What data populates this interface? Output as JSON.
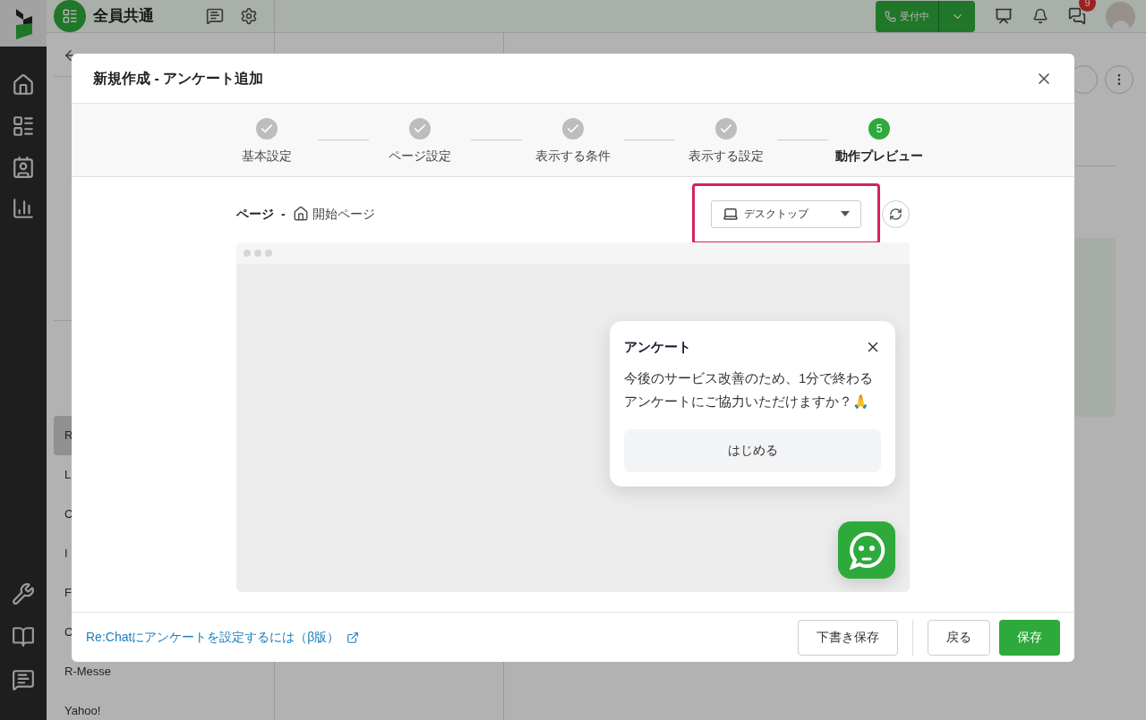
{
  "topbar": {
    "workspace": "全員共通",
    "status_button": "受付中",
    "notification_count": "9"
  },
  "sidebar": {
    "items": [
      {
        "label": "R",
        "selected": true
      },
      {
        "label": "L",
        "selected": false
      },
      {
        "label": "C",
        "selected": false
      },
      {
        "label": "I",
        "selected": false
      },
      {
        "label": "F",
        "selected": false
      },
      {
        "label": "C",
        "selected": false
      },
      {
        "label": "R-Messe",
        "selected": false
      },
      {
        "label": "Yahoo!",
        "selected": false
      }
    ]
  },
  "modal": {
    "title": "新規作成 - アンケート追加",
    "steps": [
      {
        "label": "基本設定",
        "done": true,
        "current": false
      },
      {
        "label": "ページ設定",
        "done": true,
        "current": false
      },
      {
        "label": "表示する条件",
        "done": true,
        "current": false
      },
      {
        "label": "表示する設定",
        "done": true,
        "current": false
      },
      {
        "label": "動作プレビュー",
        "done": false,
        "current": true,
        "number": "5"
      }
    ],
    "page_label": "ページ",
    "page_separator": "-",
    "page_name": "開始ページ",
    "device_select": {
      "value": "デスクトップ"
    },
    "survey": {
      "title": "アンケート",
      "message": "今後のサービス改善のため、1分で終わるアンケートにご協力いただけますか？🙏",
      "start_button": "はじめる"
    },
    "help_link": "Re:Chatにアンケートを設定するには（β版）",
    "buttons": {
      "draft": "下書き保存",
      "back": "戻る",
      "save": "保存"
    }
  }
}
